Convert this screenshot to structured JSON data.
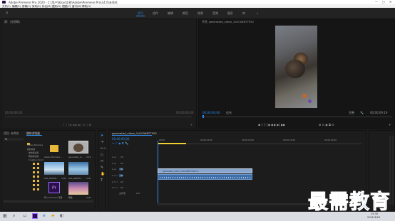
{
  "app": {
    "title": "Adobe Premiere Pro 2020 - C:\\用户\\Jkloy\\文档\\Adobe\\Premiere Pro\\14.0\\未命名",
    "window_controls": [
      "—",
      "□",
      "✕"
    ]
  },
  "menu": [
    "文件(F)",
    "编辑(E)",
    "剪辑(C)",
    "序列(S)",
    "标记(M)",
    "图形(G)",
    "视图(V)",
    "窗口(W)",
    "帮助(H)"
  ],
  "workspaces": {
    "tabs": [
      "学习",
      "组件",
      "编辑",
      "颜色",
      "效果",
      "音频",
      "图形",
      "库"
    ],
    "active_index": 0,
    "more": "»"
  },
  "source_panel": {
    "title": "源：(无剪辑)",
    "timecode_left": "00;00;00;00",
    "timecode_right": "00;00;00;00"
  },
  "program_panel": {
    "title": "节目: generated_video_1d1C068T7552",
    "timecode": "00;00;00;00",
    "fit": "适合",
    "quality": "完整",
    "duration": "00;00;09;19"
  },
  "project_panel": {
    "tabs": [
      "项目: 未命名",
      "媒体浏览器"
    ],
    "items": [
      {
        "name": "Adobe Premiere ...",
        "type": "folder"
      },
      {
        "name": "generated_vi...",
        "duration": "9;19",
        "type": "video"
      },
      {
        "name": "test_0ZZI38...",
        "duration": "4;06",
        "type": "image"
      },
      {
        "name": "test_0ZZI38...",
        "duration": "4;00",
        "type": "image"
      },
      {
        "name": "导入 Premiere 项目",
        "type": "pr"
      },
      {
        "name": "图像",
        "duration": "4;00",
        "type": "image"
      }
    ],
    "tree": [
      "Adobe Premiere",
      "我的系统",
      "本地驱动器",
      "网络驱动器",
      "Creative Cloud"
    ]
  },
  "timeline": {
    "title": "generated_video_1d1C068T7552",
    "timecode": "00;00;00;00",
    "ruler": [
      "00;00",
      "00;00;05;00",
      "00;00;10;00",
      "00;00;15;00",
      "00;00;20;00"
    ],
    "clip_label": "generated_video_1d1C068T7552(V)",
    "tracks": [
      "V3",
      "V2",
      "V1",
      "A1",
      "A2",
      "A3",
      "主声道"
    ],
    "master_value": "0.0"
  },
  "taskbar": {
    "time": "15:30",
    "date": "2021/3/26"
  },
  "watermark": "最需教育",
  "colors": {
    "accent": "#2d8ceb",
    "clip_video": "#8aa6cf",
    "clip_audio": "#3f6fa8",
    "playhead": "#f0d030",
    "premiere_purple": "#2a0f48"
  }
}
